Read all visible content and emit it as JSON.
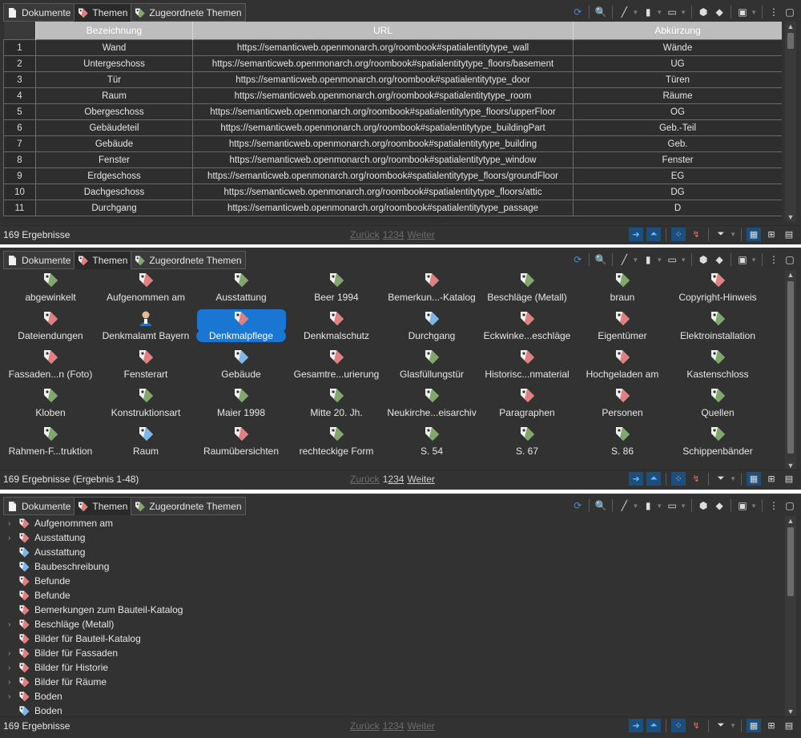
{
  "tabs": [
    {
      "label": "Dokumente",
      "icon": "document-icon"
    },
    {
      "label": "Themen",
      "icon": "tag-icon"
    },
    {
      "label": "Zugeordnete Themen",
      "icon": "tag-icon"
    }
  ],
  "table": {
    "headers": [
      "Bezeichnung",
      "URL",
      "Abkürzung"
    ],
    "rows": [
      [
        "1",
        "Wand",
        "https://semanticweb.openmonarch.org/roombook#spatialentitytype_wall",
        "Wände"
      ],
      [
        "2",
        "Untergeschoss",
        "https://semanticweb.openmonarch.org/roombook#spatialentitytype_floors/basement",
        "UG"
      ],
      [
        "3",
        "Tür",
        "https://semanticweb.openmonarch.org/roombook#spatialentitytype_door",
        "Türen"
      ],
      [
        "4",
        "Raum",
        "https://semanticweb.openmonarch.org/roombook#spatialentitytype_room",
        "Räume"
      ],
      [
        "5",
        "Obergeschoss",
        "https://semanticweb.openmonarch.org/roombook#spatialentitytype_floors/upperFloor",
        "OG"
      ],
      [
        "6",
        "Gebäudeteil",
        "https://semanticweb.openmonarch.org/roombook#spatialentitytype_buildingPart",
        "Geb.-Teil"
      ],
      [
        "7",
        "Gebäude",
        "https://semanticweb.openmonarch.org/roombook#spatialentitytype_building",
        "Geb."
      ],
      [
        "8",
        "Fenster",
        "https://semanticweb.openmonarch.org/roombook#spatialentitytype_window",
        "Fenster"
      ],
      [
        "9",
        "Erdgeschoss",
        "https://semanticweb.openmonarch.org/roombook#spatialentitytype_floors/groundFloor",
        "EG"
      ],
      [
        "10",
        "Dachgeschoss",
        "https://semanticweb.openmonarch.org/roombook#spatialentitytype_floors/attic",
        "DG"
      ],
      [
        "11",
        "Durchgang",
        "https://semanticweb.openmonarch.org/roombook#spatialentitytype_passage",
        "D"
      ]
    ]
  },
  "panel1_status": {
    "results": "169 Ergebnisse",
    "prev": "Zurück",
    "pages": [
      "1",
      "2",
      "3",
      "4"
    ],
    "next": "Weiter"
  },
  "panel2_status": {
    "results": "169 Ergebnisse (Ergebnis 1-48)",
    "prev": "Zurück",
    "pages": [
      "1",
      "2",
      "3",
      "4"
    ],
    "next": "Weiter"
  },
  "panel3_status": {
    "results": "169 Ergebnisse",
    "prev": "Zurück",
    "pages": [
      "1",
      "2",
      "3",
      "4"
    ],
    "next": "Weiter"
  },
  "grid_items": [
    {
      "label": "abgewinkelt",
      "color": "green"
    },
    {
      "label": "Aufgenommen am",
      "color": "red"
    },
    {
      "label": "Ausstattung",
      "color": "green"
    },
    {
      "label": "Beer 1994",
      "color": "green"
    },
    {
      "label": "Bemerkun...-Katalog",
      "color": "red"
    },
    {
      "label": "Beschläge (Metall)",
      "color": "green"
    },
    {
      "label": "braun",
      "color": "green"
    },
    {
      "label": "Copyright-Hinweis",
      "color": "red"
    },
    {
      "label": "Dateiendungen",
      "color": "red"
    },
    {
      "label": "Denkmalamt Bayern",
      "color": "person"
    },
    {
      "label": "Denkmalpflege",
      "color": "red"
    },
    {
      "label": "Denkmalschutz",
      "color": "red"
    },
    {
      "label": "Durchgang",
      "color": "blue"
    },
    {
      "label": "Eckwinke...eschläge",
      "color": "red"
    },
    {
      "label": "Eigentümer",
      "color": "red"
    },
    {
      "label": "Elektroinstallation",
      "color": "green"
    },
    {
      "label": "Fassaden...n (Foto)",
      "color": "red"
    },
    {
      "label": "Fensterart",
      "color": "red"
    },
    {
      "label": "Gebäude",
      "color": "blue"
    },
    {
      "label": "Gesamtre...urierung",
      "color": "red"
    },
    {
      "label": "Glasfüllungstür",
      "color": "green"
    },
    {
      "label": "Historisc...nmaterial",
      "color": "red"
    },
    {
      "label": "Hochgeladen am",
      "color": "red"
    },
    {
      "label": "Kastenschloss",
      "color": "green"
    },
    {
      "label": "Kloben",
      "color": "green"
    },
    {
      "label": "Konstruktionsart",
      "color": "green"
    },
    {
      "label": "Maier 1998",
      "color": "green"
    },
    {
      "label": "Mitte 20. Jh.",
      "color": "green"
    },
    {
      "label": "Neukirche...eisarchiv",
      "color": "green"
    },
    {
      "label": "Paragraphen",
      "color": "red"
    },
    {
      "label": "Personen",
      "color": "red"
    },
    {
      "label": "Quellen",
      "color": "green"
    },
    {
      "label": "Rahmen-F...truktion",
      "color": "green"
    },
    {
      "label": "Raum",
      "color": "blue"
    },
    {
      "label": "Raumübersichten",
      "color": "red"
    },
    {
      "label": "rechteckige Form",
      "color": "green"
    },
    {
      "label": "S. 54",
      "color": "green"
    },
    {
      "label": "S. 67",
      "color": "green"
    },
    {
      "label": "S. 86",
      "color": "green"
    },
    {
      "label": "Schippenbänder",
      "color": "green"
    }
  ],
  "selected_grid_item": "Denkmalpflege",
  "tree_items": [
    {
      "label": "Aufgenommen am",
      "expandable": true,
      "color": "red"
    },
    {
      "label": "Ausstattung",
      "expandable": true,
      "color": "red"
    },
    {
      "label": "Ausstattung",
      "expandable": false,
      "color": "blue"
    },
    {
      "label": "Baubeschreibung",
      "expandable": false,
      "color": "blue"
    },
    {
      "label": "Befunde",
      "expandable": false,
      "color": "red"
    },
    {
      "label": "Befunde",
      "expandable": false,
      "color": "red"
    },
    {
      "label": "Bemerkungen zum Bauteil-Katalog",
      "expandable": false,
      "color": "red"
    },
    {
      "label": "Beschläge (Metall)",
      "expandable": true,
      "color": "red"
    },
    {
      "label": "Bilder für Bauteil-Katalog",
      "expandable": false,
      "color": "red"
    },
    {
      "label": "Bilder für Fassaden",
      "expandable": true,
      "color": "red"
    },
    {
      "label": "Bilder für Historie",
      "expandable": true,
      "color": "red"
    },
    {
      "label": "Bilder für Räume",
      "expandable": true,
      "color": "red"
    },
    {
      "label": "Boden",
      "expandable": true,
      "color": "red"
    },
    {
      "label": "Boden",
      "expandable": false,
      "color": "blue"
    }
  ],
  "colors": {
    "green": "#7fa86a",
    "red": "#e08080",
    "blue": "#7eb6e8",
    "accent": "#1976d2",
    "background": "#323232"
  }
}
